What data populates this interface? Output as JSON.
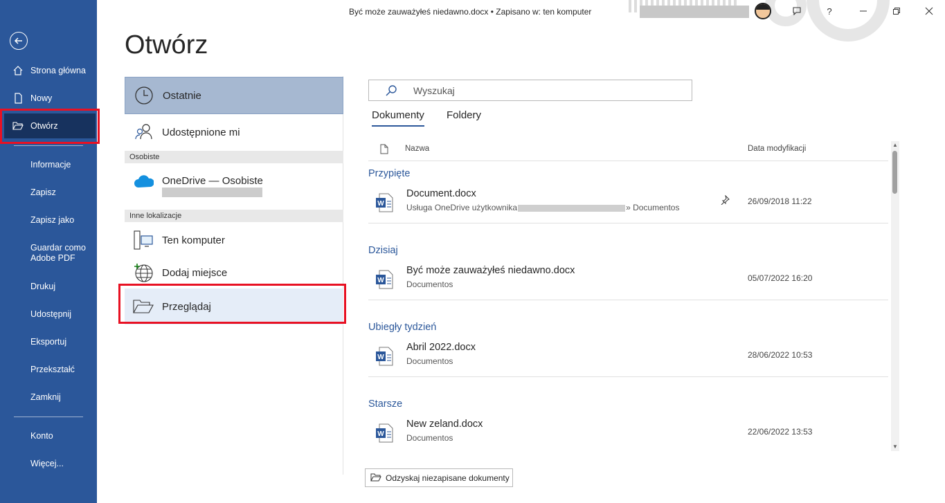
{
  "titlebar": {
    "document_title": "Być może zauważyłeś niedawno.docx • Zapisano w: ten komputer",
    "help_label": "?"
  },
  "sidebar": {
    "items": [
      {
        "label": "Strona główna",
        "icon": "home-icon"
      },
      {
        "label": "Nowy",
        "icon": "new-document-icon"
      },
      {
        "label": "Otwórz",
        "icon": "folder-open-icon"
      },
      {
        "label": "Informacje"
      },
      {
        "label": "Zapisz"
      },
      {
        "label": "Zapisz jako"
      },
      {
        "label": "Guardar como Adobe PDF"
      },
      {
        "label": "Drukuj"
      },
      {
        "label": "Udostępnij"
      },
      {
        "label": "Eksportuj"
      },
      {
        "label": "Przekształć"
      },
      {
        "label": "Zamknij"
      },
      {
        "label": "Konto"
      },
      {
        "label": "Więcej..."
      }
    ],
    "guardar_line1": "Guardar como",
    "guardar_line2": "Adobe PDF"
  },
  "page": {
    "title": "Otwórz"
  },
  "locations": {
    "recent": "Ostatnie",
    "shared": "Udostępnione mi",
    "personal_header": "Osobiste",
    "onedrive": "OneDrive — Osobiste",
    "other_header": "Inne lokalizacje",
    "this_pc": "Ten komputer",
    "add_place": "Dodaj miejsce",
    "browse": "Przeglądaj"
  },
  "search": {
    "placeholder": "Wyszukaj"
  },
  "tabs": {
    "documents": "Dokumenty",
    "folders": "Foldery"
  },
  "columns": {
    "name": "Nazwa",
    "modified": "Data modyfikacji"
  },
  "groups": {
    "pinned": "Przypięte",
    "today": "Dzisiaj",
    "last_week": "Ubiegły tydzień",
    "older": "Starsze"
  },
  "files": [
    {
      "name": "Document.docx",
      "path_prefix": "Usługa OneDrive użytkownika",
      "path_suffix": "» Documentos",
      "date": "26/09/2018 11:22",
      "pinned": true
    },
    {
      "name": "Być może zauważyłeś niedawno.docx",
      "path": "Documentos",
      "date": "05/07/2022 16:20"
    },
    {
      "name": "Abril 2022.docx",
      "path": "Documentos",
      "date": "28/06/2022 10:53"
    },
    {
      "name": "New zeland.docx",
      "path": "Documentos",
      "date": "22/06/2022 13:53"
    }
  ],
  "recover_button": "Odzyskaj niezapisane dokumenty",
  "colors": {
    "sidebar": "#2b579a",
    "sidebar_active": "#17325e",
    "highlight": "#e81123",
    "accent_text": "#2b579a"
  }
}
